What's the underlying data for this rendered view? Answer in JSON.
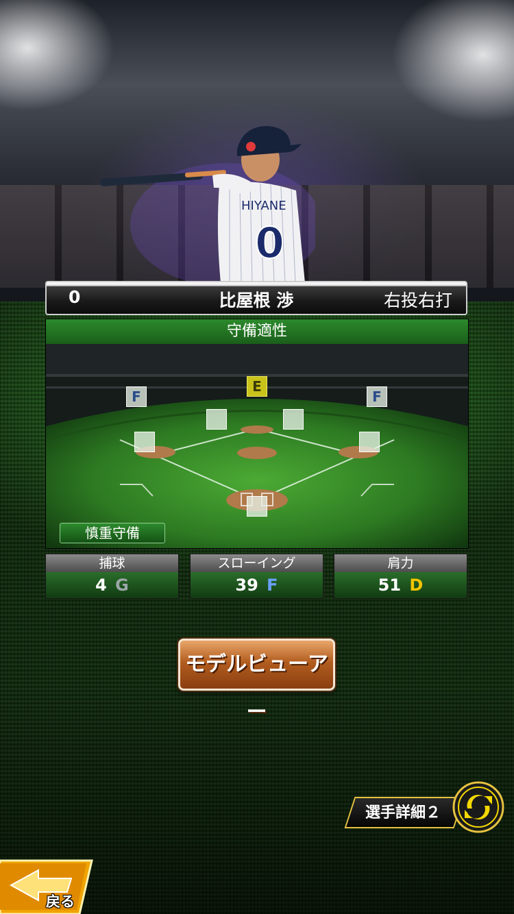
{
  "player": {
    "number": "0",
    "name": "比屋根 渉",
    "throw_bat": "右投右打",
    "jersey_name": "HIYANE",
    "jersey_number": "0"
  },
  "defense": {
    "title": "守備適性",
    "positions": [
      {
        "position": "left-field",
        "grade": "F"
      },
      {
        "position": "center-field",
        "grade": "E"
      },
      {
        "position": "right-field",
        "grade": "F"
      },
      {
        "position": "shortstop",
        "grade": ""
      },
      {
        "position": "second-base",
        "grade": ""
      },
      {
        "position": "third-base",
        "grade": ""
      },
      {
        "position": "first-base",
        "grade": ""
      },
      {
        "position": "catcher",
        "grade": ""
      }
    ],
    "skill_tag": "慎重守備"
  },
  "stats": [
    {
      "label": "捕球",
      "value": "4",
      "grade": "G",
      "grade_color": "#9aa6a6"
    },
    {
      "label": "スローイング",
      "value": "39",
      "grade": "F",
      "grade_color": "#6aa0ff"
    },
    {
      "label": "肩力",
      "value": "51",
      "grade": "D",
      "grade_color": "#f2c400"
    }
  ],
  "buttons": {
    "model_viewer": "モデルビューアー",
    "player_detail": "選手詳細２",
    "back": "戻る"
  },
  "icons": {
    "swap": "swap-arrows-icon",
    "back": "back-arrow-icon"
  },
  "colors": {
    "accent_gold": "#e6c240",
    "panel_green": "#2c8a2c"
  }
}
